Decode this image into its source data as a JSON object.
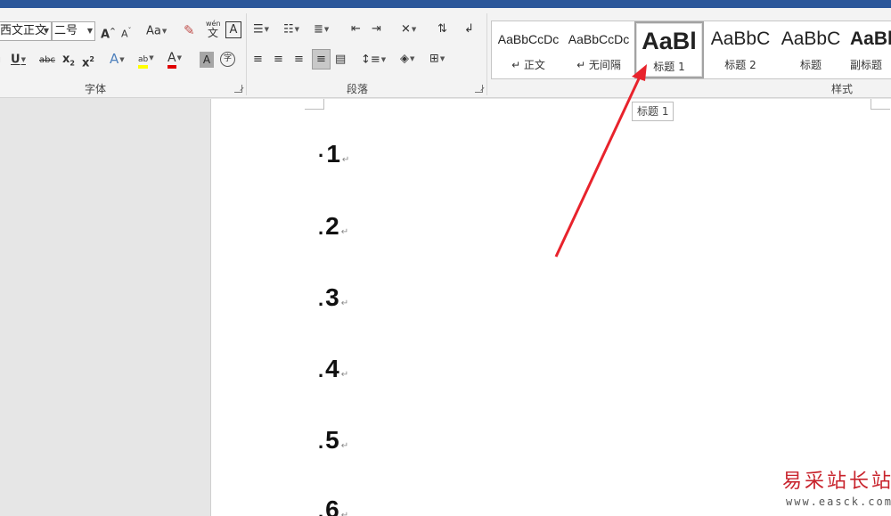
{
  "font_group": {
    "font_name": "西文正文",
    "font_size": "二号",
    "label": "字体",
    "grow_glyph": "A",
    "shrink_glyph": "A",
    "case_glyph": "Aa",
    "pinyin_small": "wén",
    "pinyin_big": "文",
    "border_char_glyph": "A",
    "underline_glyph": "U",
    "strike_glyph": "abc",
    "subscript_glyph": "x",
    "superscript_glyph": "x",
    "text_effect_glyph": "A",
    "highlight_glyph": "ab",
    "font_color_glyph": "A",
    "char_shading_glyph": "A",
    "enclose_glyph": "字"
  },
  "paragraph_group": {
    "label": "段落"
  },
  "styles_group": {
    "label": "样式",
    "items": [
      {
        "sample": "AaBbCcDc",
        "name": "↵ 正文"
      },
      {
        "sample": "AaBbCcDc",
        "name": "↵ 无间隔"
      },
      {
        "sample": "AaBl",
        "name": "标题 1"
      },
      {
        "sample": "AaBbC",
        "name": "标题 2"
      },
      {
        "sample": "AaBbC",
        "name": "标题"
      },
      {
        "sample": "AaBl",
        "name": "副标题"
      }
    ]
  },
  "tooltip": "标题 1",
  "document": {
    "headings": [
      "1",
      "2",
      "3",
      "4",
      "5",
      "6"
    ],
    "paragraph_mark": "↵"
  },
  "watermark": {
    "text": "易采站长站",
    "url": "www.easck.com"
  },
  "colors": {
    "titlebar": "#2b579a",
    "arrow": "#e8232c",
    "highlight": "#ffff00",
    "font_color": "#e00000"
  }
}
